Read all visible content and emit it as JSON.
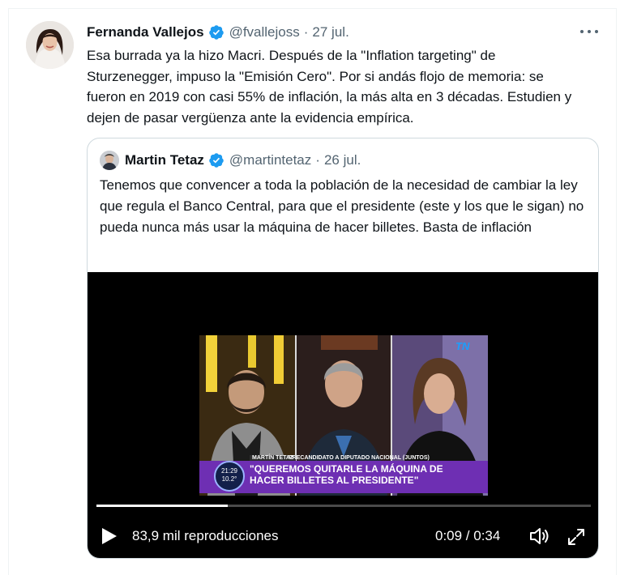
{
  "tweet": {
    "author_name": "Fernanda Vallejos",
    "author_handle": "@fvallejoss",
    "separator": "·",
    "date": "27 jul.",
    "text": "Esa burrada ya la hizo Macri. Después de la \"Inflation targeting\" de Sturzenegger, impuso la \"Emisión Cero\". Por si andás flojo de memoria: se fueron en 2019 con casi 55% de inflación, la más alta en 3 décadas. Estudien y dejen de pasar vergüenza ante la evidencia empírica."
  },
  "quoted_tweet": {
    "author_name": "Martin Tetaz",
    "author_handle": "@martintetaz",
    "separator": "·",
    "date": "26 jul.",
    "text": "Tenemos que convencer a toda la población de la necesidad de cambiar la ley que regula el Banco Central, para que el presidente (este y los que le sigan) no pueda nunca más usar la máquina de hacer billetes. Basta de inflación"
  },
  "video": {
    "caption_name": "MARTÍN TETAZ",
    "caption_role": "PRECANDIDATO A DIPUTADO NACIONAL (JUNTOS)",
    "caption_line1": "\"QUEREMOS QUITARLE LA MÁQUINA DE",
    "caption_line2": "HACER BILLETES AL PRESIDENTE\"",
    "clock_time": "21:29",
    "clock_temp": "10.2°",
    "channel_logo": "TN",
    "views": "83,9 mil reproducciones",
    "time_display": "0:09 / 0:34",
    "progress": 0.265
  },
  "icons": {
    "verified": "verified-badge-icon",
    "more": "more-options-icon",
    "play": "play-icon",
    "volume": "volume-icon",
    "fullscreen": "fullscreen-icon"
  },
  "colors": {
    "verified": "#1d9bf0",
    "secondary_text": "#536471",
    "caption_purple": "#6e2fb3"
  }
}
